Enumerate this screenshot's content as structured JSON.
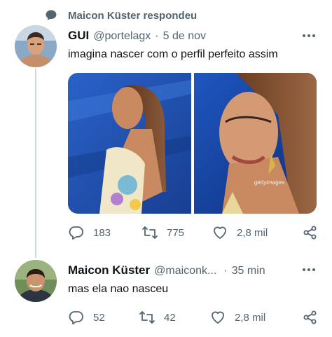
{
  "context": {
    "text": "Maicon Küster respondeu",
    "icon": "speech-bubble-icon"
  },
  "tweets": [
    {
      "name": "GUI",
      "handle": "@portelagx",
      "separator": "·",
      "time": "5 de nov",
      "text": "imagina nascer com o perfil perfeito assim",
      "watermark": "gettyimages",
      "stats": {
        "replies": "183",
        "retweets": "775",
        "likes": "2,8 mil"
      }
    },
    {
      "name": "Maicon Küster",
      "handle": "@maiconk...",
      "separator": "·",
      "time": "35 min",
      "text": "mas ela nao nasceu",
      "stats": {
        "replies": "52",
        "retweets": "42",
        "likes": "2,8 mil"
      }
    }
  ],
  "icons": {
    "reply": "reply-icon",
    "retweet": "retweet-icon",
    "like": "heart-icon",
    "share": "share-icon",
    "more": "more-icon"
  },
  "colors": {
    "text": "#0f1419",
    "secondary": "#536471",
    "line": "#cfd9de",
    "media_blue": "#1f4fb0"
  }
}
